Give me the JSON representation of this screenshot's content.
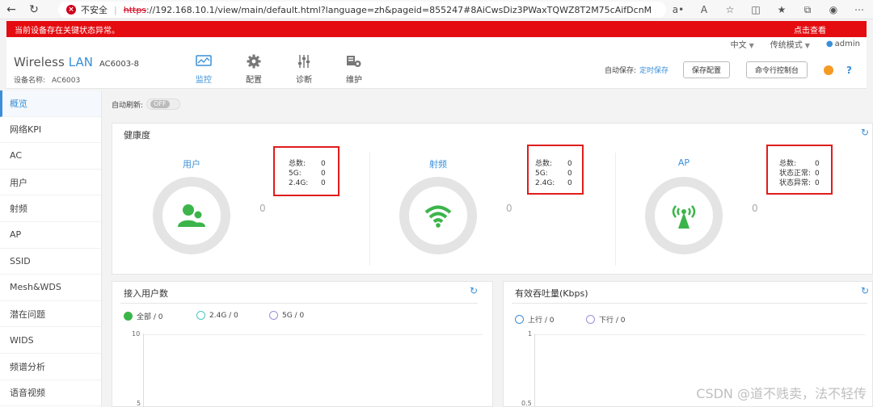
{
  "browser": {
    "insecure_label": "不安全",
    "url_protocol": "https",
    "url_rest": "://192.168.10.1/view/main/default.html?language=zh&pageid=855247#8AiCwsDiz3PWaxTQWZ8T2M75cAifDcnM"
  },
  "alert": {
    "message": "当前设备存在关键状态异常。",
    "link": "点击查看"
  },
  "util": {
    "language": "中文",
    "mode": "传统模式",
    "user": "admin"
  },
  "header": {
    "brand_wireless": "Wireless",
    "brand_lan": "LAN",
    "model": "AC6003-8",
    "device_name_label": "设备名称:",
    "device_name_value": "AC6003",
    "tabs": [
      {
        "label": "监控",
        "icon": "monitor-icon",
        "active": true
      },
      {
        "label": "配置",
        "icon": "gear-icon"
      },
      {
        "label": "诊断",
        "icon": "sliders-icon"
      },
      {
        "label": "维护",
        "icon": "maintenance-icon"
      }
    ],
    "autosave_label": "自动保存:",
    "autosave_value": "定时保存",
    "save_button": "保存配置",
    "console_button": "命令行控制台"
  },
  "sidebar": {
    "items": [
      {
        "label": "概览",
        "active": true
      },
      {
        "label": "网络KPI"
      },
      {
        "label": "AC"
      },
      {
        "label": "用户"
      },
      {
        "label": "射频"
      },
      {
        "label": "AP"
      },
      {
        "label": "SSID"
      },
      {
        "label": "Mesh&WDS"
      },
      {
        "label": "潜在问题"
      },
      {
        "label": "WIDS"
      },
      {
        "label": "频谱分析"
      },
      {
        "label": "语音视频"
      }
    ]
  },
  "main": {
    "auto_refresh_label": "自动刷新:",
    "auto_refresh_state": "OFF",
    "health": {
      "title": "健康度",
      "columns": [
        {
          "title": "用户",
          "center_value": "0",
          "stats": [
            {
              "k": "总数:",
              "v": "0"
            },
            {
              "k": "5G:",
              "v": "0"
            },
            {
              "k": "2.4G:",
              "v": "0"
            }
          ]
        },
        {
          "title": "射频",
          "center_value": "0",
          "stats": [
            {
              "k": "总数:",
              "v": "0"
            },
            {
              "k": "5G:",
              "v": "0"
            },
            {
              "k": "2.4G:",
              "v": "0"
            }
          ]
        },
        {
          "title": "AP",
          "center_value": "0",
          "stats": [
            {
              "k": "总数:",
              "v": "0"
            },
            {
              "k": "状态正常:",
              "v": "0"
            },
            {
              "k": "状态异常:",
              "v": "0"
            }
          ]
        }
      ]
    },
    "users_panel": {
      "title": "接入用户数",
      "legend": [
        "全部 / 0",
        "2.4G / 0",
        "5G / 0"
      ],
      "y_ticks": [
        "10",
        "5"
      ]
    },
    "throughput_panel": {
      "title": "有效吞吐量(Kbps)",
      "legend": [
        "上行 / 0",
        "下行 / 0"
      ],
      "y_ticks": [
        "1",
        "0.5"
      ]
    }
  },
  "watermark": "CSDN @道不贱卖，法不轻传",
  "colors": {
    "accent": "#3a8fd8",
    "alert": "#e40c10",
    "icon_green": "#3bb54a",
    "highlight_box": "#e01c1c"
  }
}
